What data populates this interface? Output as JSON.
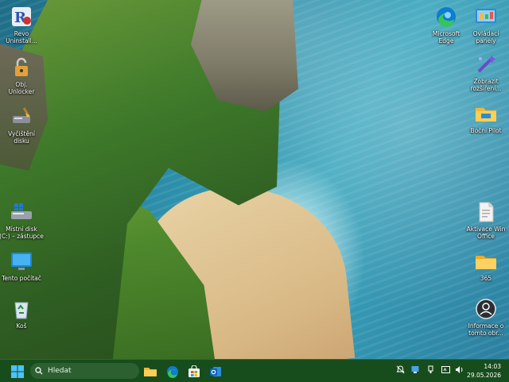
{
  "desktop": {
    "icons_left": [
      {
        "label": "Revo\nUninstall..."
      },
      {
        "label": "Obj.\nUnlocker"
      },
      {
        "label": "Vyčištění\ndisku"
      },
      {
        "label": "Místní disk\n(C:) – zástupce"
      },
      {
        "label": "Tento počítač"
      },
      {
        "label": "Koš"
      }
    ],
    "icons_right": [
      {
        "label": "Microsoft\nEdge"
      },
      {
        "label": "Ovládací\npanely"
      },
      {
        "label": "Zobrazit\nrozšíření..."
      },
      {
        "label": "Boční Pilot"
      },
      {
        "label": "Aktivace Win\nOffice"
      },
      {
        "label": "365"
      },
      {
        "label": "Informace o\ntomto obr..."
      }
    ]
  },
  "taskbar": {
    "start_icon": "windows-logo",
    "search_placeholder": "Hledat",
    "pinned": [
      "file-explorer",
      "microsoft-edge",
      "microsoft-store",
      "outlook"
    ],
    "tray_icons": [
      "hidden-icons",
      "network",
      "usb",
      "language",
      "volume"
    ],
    "time": "14:03",
    "date": "29.05.2026",
    "accent_color": "#174d1c"
  }
}
